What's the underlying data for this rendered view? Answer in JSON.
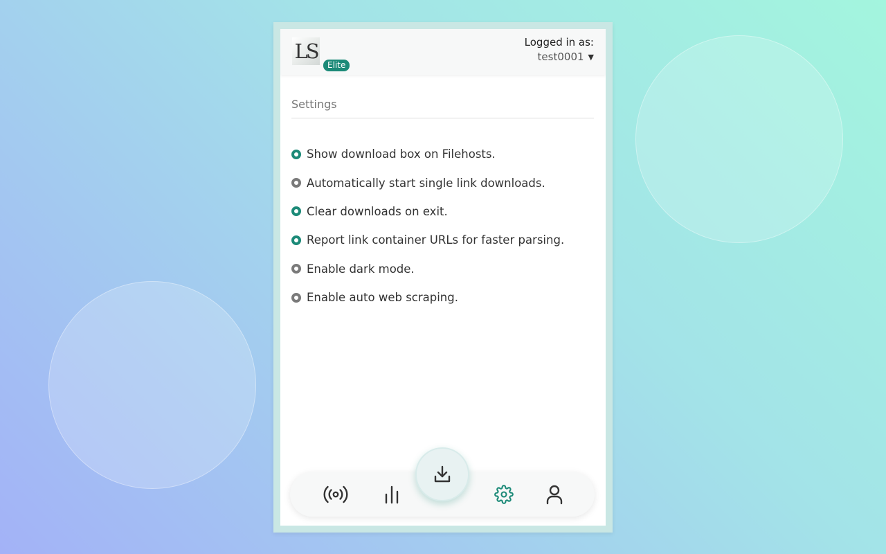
{
  "colors": {
    "accent": "#1c8a78",
    "radio_off": "#7a7a7a",
    "text": "#333333"
  },
  "header": {
    "logo_text": "LS",
    "badge": "Elite",
    "logged_in_label": "Logged in as:",
    "username": "test0001"
  },
  "settings": {
    "title": "Settings",
    "options": [
      {
        "label": "Show download box on Filehosts.",
        "enabled": true
      },
      {
        "label": "Automatically start single link downloads.",
        "enabled": false
      },
      {
        "label": "Clear downloads on exit.",
        "enabled": true
      },
      {
        "label": "Report link container URLs for faster parsing.",
        "enabled": true
      },
      {
        "label": "Enable dark mode.",
        "enabled": false
      },
      {
        "label": "Enable auto web scraping.",
        "enabled": false
      }
    ]
  },
  "nav": {
    "items": [
      {
        "icon": "broadcast-icon",
        "active": false
      },
      {
        "icon": "bar-chart-icon",
        "active": false
      },
      {
        "icon": "download-icon",
        "active": false
      },
      {
        "icon": "gear-icon",
        "active": true
      },
      {
        "icon": "user-icon",
        "active": false
      }
    ]
  }
}
